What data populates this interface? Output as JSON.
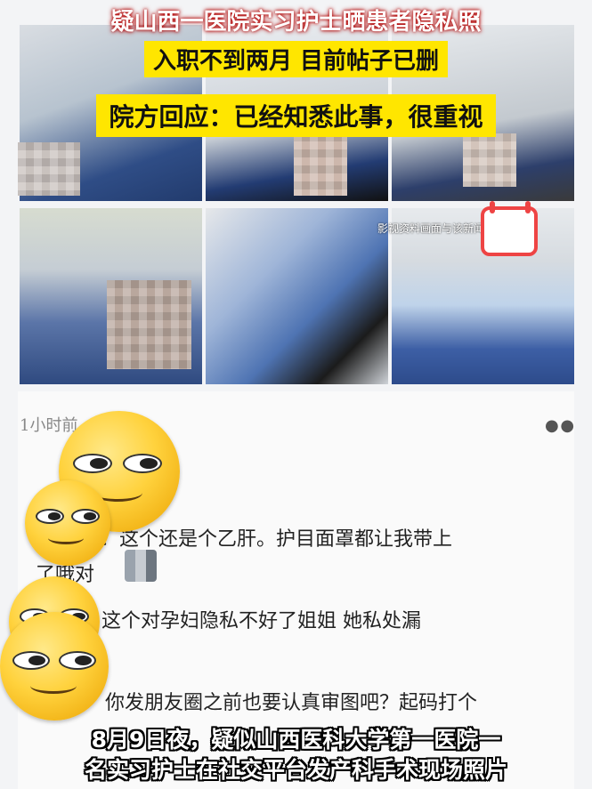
{
  "headlines": {
    "line1": "疑山西一医院实习护士晒患者隐私照",
    "line2": "入职不到两月 目前帖子已删",
    "line3": "院方回应：已经知悉此事，很重视"
  },
  "watermark": "影视资料画面与该新闻事件无关",
  "post": {
    "time": "1小时前",
    "more_icon": "more-dots-icon",
    "comments": [
      {
        "text": "：这个还是个乙肝。护目面罩都让我带上"
      },
      {
        "text": "了哦对"
      },
      {
        "text": "这个对孕妇隐私不好了姐姐 她私处漏"
      },
      {
        "text": "你发朋友圈之前也要认真审图吧？起码打个"
      }
    ]
  },
  "caption": {
    "line1": "8月9日夜，疑似山西医科大学第一医院一",
    "line2": "名实习护士在社交平台发产科手术现场照片"
  },
  "colors": {
    "headline_bg": "#ffe600",
    "headline_outline": "#b00000",
    "emoji": "#ffd23d"
  }
}
